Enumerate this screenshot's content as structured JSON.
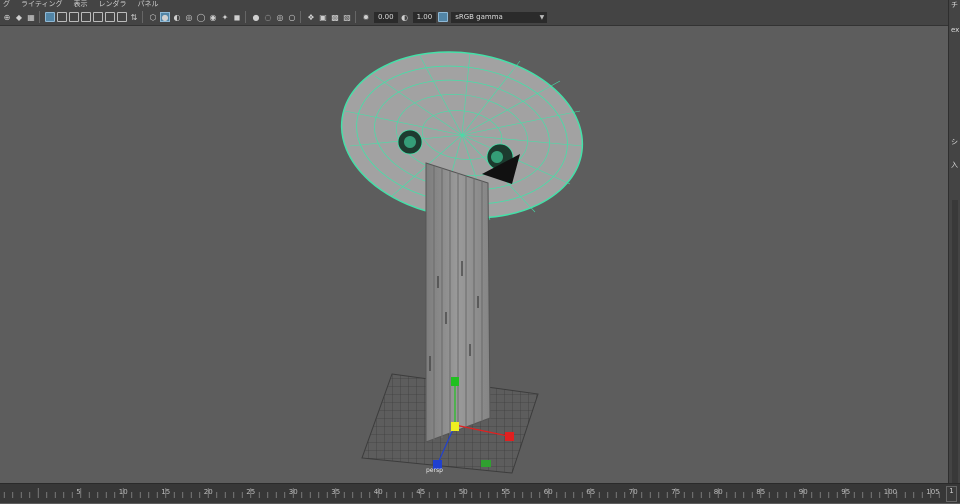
{
  "menu": {
    "items": [
      "グ",
      "ライティング",
      "表示",
      "レンダラ",
      "パネル"
    ]
  },
  "toolbar": {
    "exposure_value": "0.00",
    "gamma_value": "1.00",
    "color_space": "sRGB gamma"
  },
  "right_panel": {
    "frag1": "チ",
    "frag2": "ex",
    "frag3": "シ",
    "frag4": "入"
  },
  "viewport": {
    "camera_label": "persp",
    "wire_color": "#44e0a8",
    "manip_x_color": "#e02020",
    "manip_y_color": "#20c020",
    "manip_z_color": "#2040d0",
    "manip_center_color": "#f0f020"
  },
  "timeline": {
    "tick_labels": [
      "5",
      "10",
      "15",
      "20",
      "25",
      "30",
      "35",
      "40",
      "45",
      "50",
      "55",
      "60",
      "65",
      "70",
      "75",
      "80",
      "85",
      "90",
      "95",
      "100",
      "105",
      "110",
      "115",
      "120"
    ],
    "current_frame": "1"
  }
}
